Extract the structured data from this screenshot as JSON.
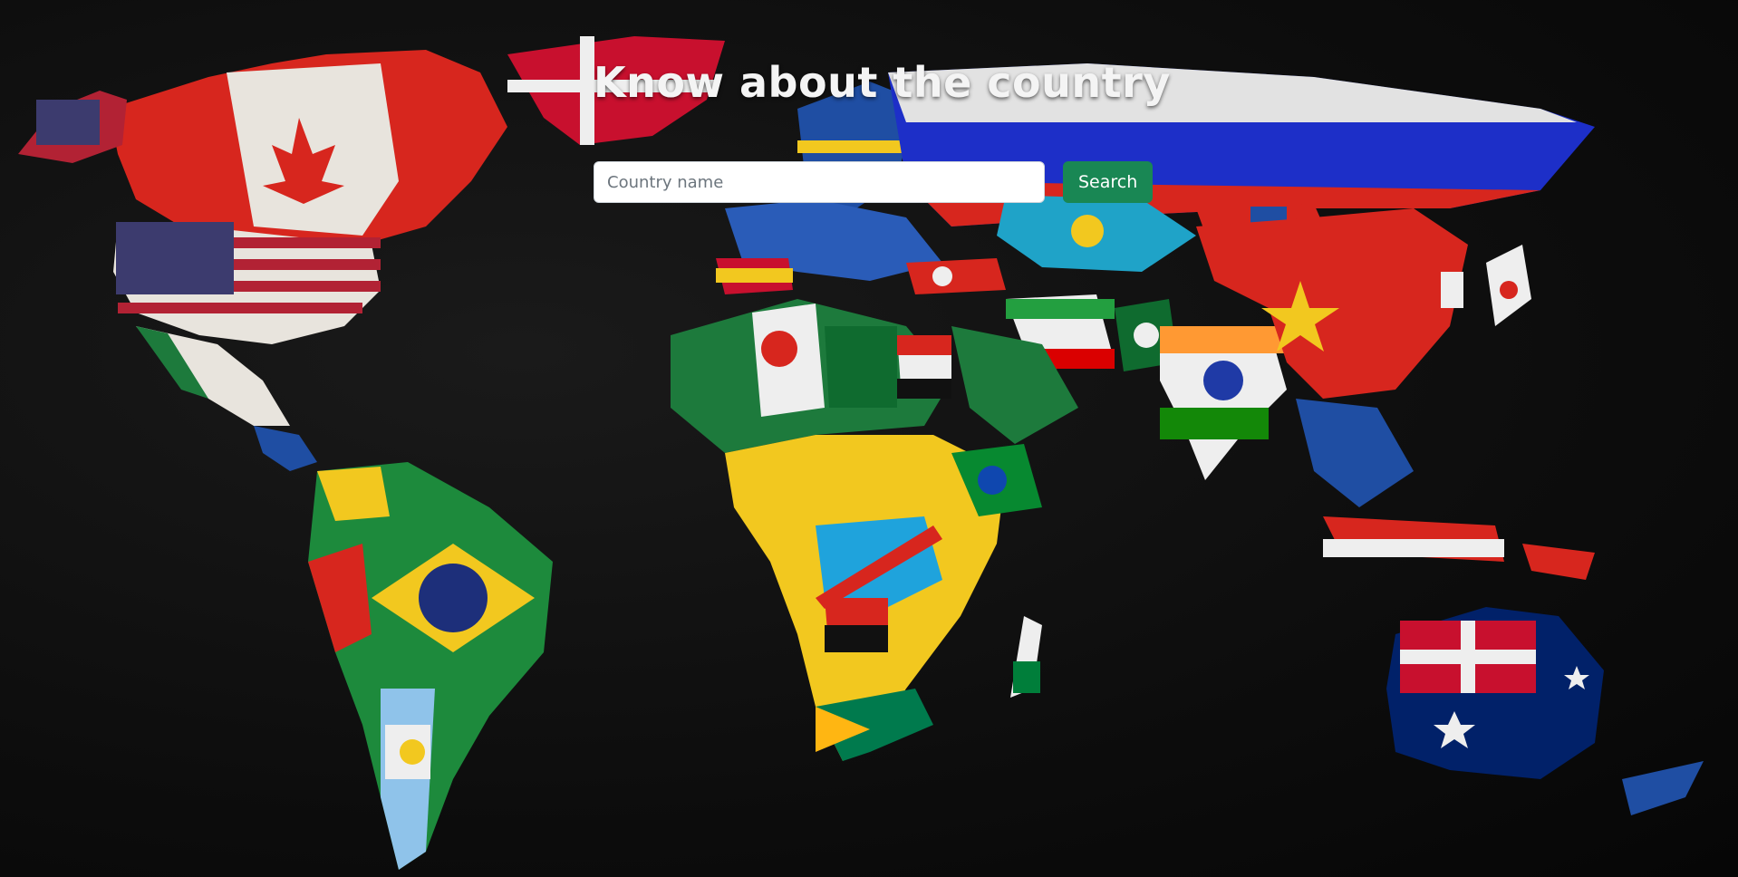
{
  "page": {
    "title": "Know about the country"
  },
  "search": {
    "placeholder": "Country name",
    "value": "",
    "button_label": "Search"
  },
  "colors": {
    "background": "#0b0b0b",
    "title_text": "#f4f4f4",
    "button_bg": "#198754",
    "input_bg": "#ffffff"
  },
  "background_image": {
    "description_icon": "world-map-flags-illustration"
  }
}
